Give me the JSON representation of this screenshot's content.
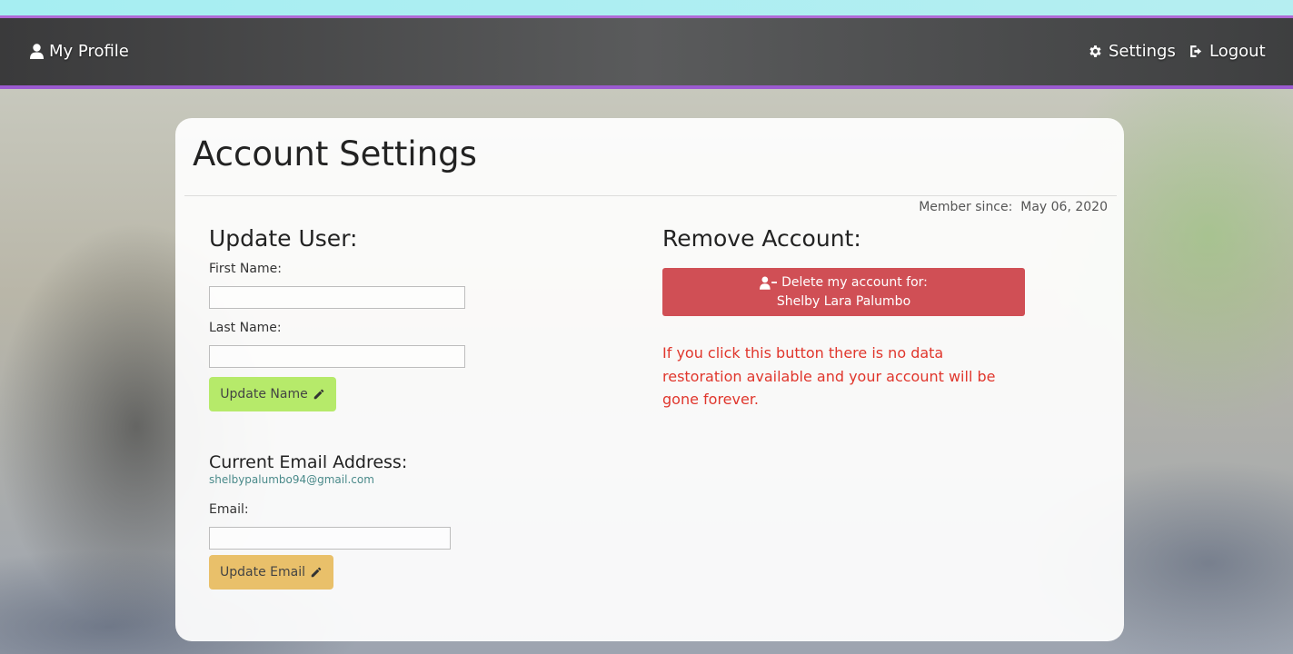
{
  "navbar": {
    "profile_label": "My Profile",
    "settings_label": "Settings",
    "logout_label": "Logout",
    "profile_icon": "user-icon",
    "settings_icon": "gear-icon",
    "logout_icon": "logout-icon"
  },
  "card": {
    "title": "Account Settings",
    "member_since_label": "Member since:",
    "member_since_date": "May 06, 2020"
  },
  "update_user": {
    "heading": "Update User:",
    "first_name_label": "First Name:",
    "first_name_value": "",
    "last_name_label": "Last Name:",
    "last_name_value": "",
    "update_name_button": "Update Name",
    "current_email_heading": "Current Email Address:",
    "current_email_value": "shelbypalumbo94@gmail.com",
    "email_label": "Email:",
    "email_value": "",
    "update_email_button": "Update Email"
  },
  "remove_account": {
    "heading": "Remove Account:",
    "delete_button_line1": "Delete my account for:",
    "delete_button_line2": "Shelby Lara Palumbo",
    "warning": "If you click this button there is no data restoration available and your account will be gone forever."
  },
  "colors": {
    "navbar_accent": "#9b5ad0",
    "update_name_button": "#b6ea6a",
    "update_email_button": "#e9c06a",
    "delete_button": "#d04f55",
    "warning_text": "#e0362c"
  }
}
